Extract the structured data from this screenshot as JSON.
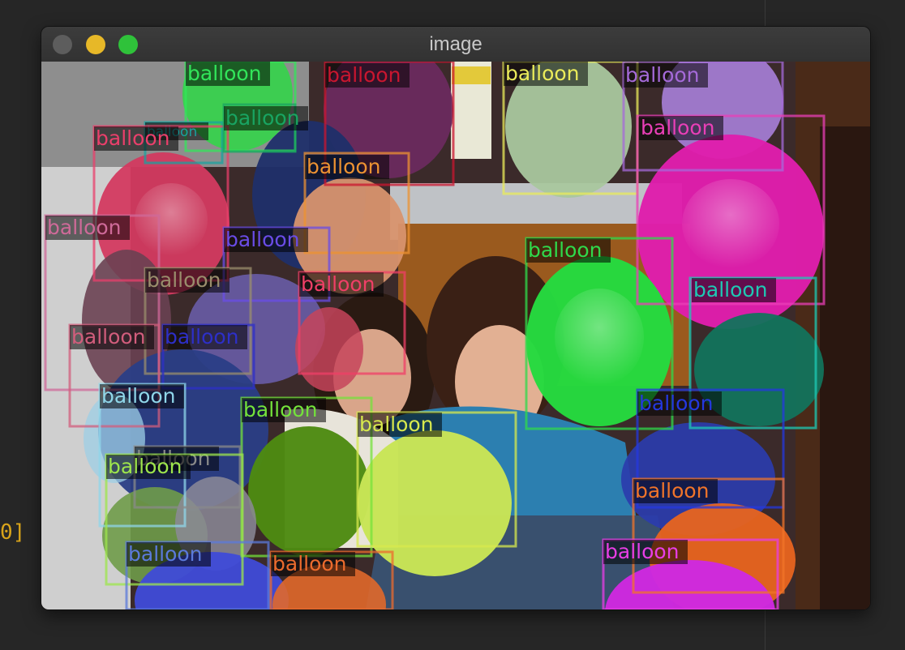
{
  "window": {
    "title": "image",
    "traffic_lights": {
      "close_color": "#5d5d5d",
      "minimize_color": "#e7b828",
      "zoom_color": "#2fc23a"
    }
  },
  "backdrop": {
    "edge_glyph": "0]"
  },
  "image": {
    "detections": [
      {
        "label": "balloon",
        "color": "#32e55a"
      },
      {
        "label": "balloon",
        "color": "#c9162f"
      },
      {
        "label": "balloon",
        "color": "#eaeb5a"
      },
      {
        "label": "balloon",
        "color": "#a56ad9"
      },
      {
        "label": "balloon",
        "color": "#1aa19f"
      },
      {
        "label": "balloon",
        "color": "#ea3f6b"
      },
      {
        "label": "balloon",
        "color": "#19a462"
      },
      {
        "label": "balloon",
        "color": "#ec9232"
      },
      {
        "label": "balloon",
        "color": "#e93fb7"
      },
      {
        "label": "balloon",
        "color": "#cf6a99"
      },
      {
        "label": "balloon",
        "color": "#6a4ce6"
      },
      {
        "label": "balloon",
        "color": "#2fd94b"
      },
      {
        "label": "balloon",
        "color": "#9a8d6c"
      },
      {
        "label": "balloon",
        "color": "#ef3f67"
      },
      {
        "label": "balloon",
        "color": "#1ec9b4"
      },
      {
        "label": "balloon",
        "color": "#d25d7c"
      },
      {
        "label": "balloon",
        "color": "#2d2fc8"
      },
      {
        "label": "balloon",
        "color": "#8fd6e9"
      },
      {
        "label": "balloon",
        "color": "#74e23b"
      },
      {
        "label": "balloon",
        "color": "#d7e84d"
      },
      {
        "label": "balloon",
        "color": "#2438df"
      },
      {
        "label": "balloon",
        "color": "#8a8a8a"
      },
      {
        "label": "balloon",
        "color": "#9ee54c"
      },
      {
        "label": "balloon",
        "color": "#f0742a"
      },
      {
        "label": "balloon",
        "color": "#5b7adb"
      },
      {
        "label": "balloon",
        "color": "#ec6b2d"
      },
      {
        "label": "balloon",
        "color": "#e83ee6"
      }
    ]
  }
}
